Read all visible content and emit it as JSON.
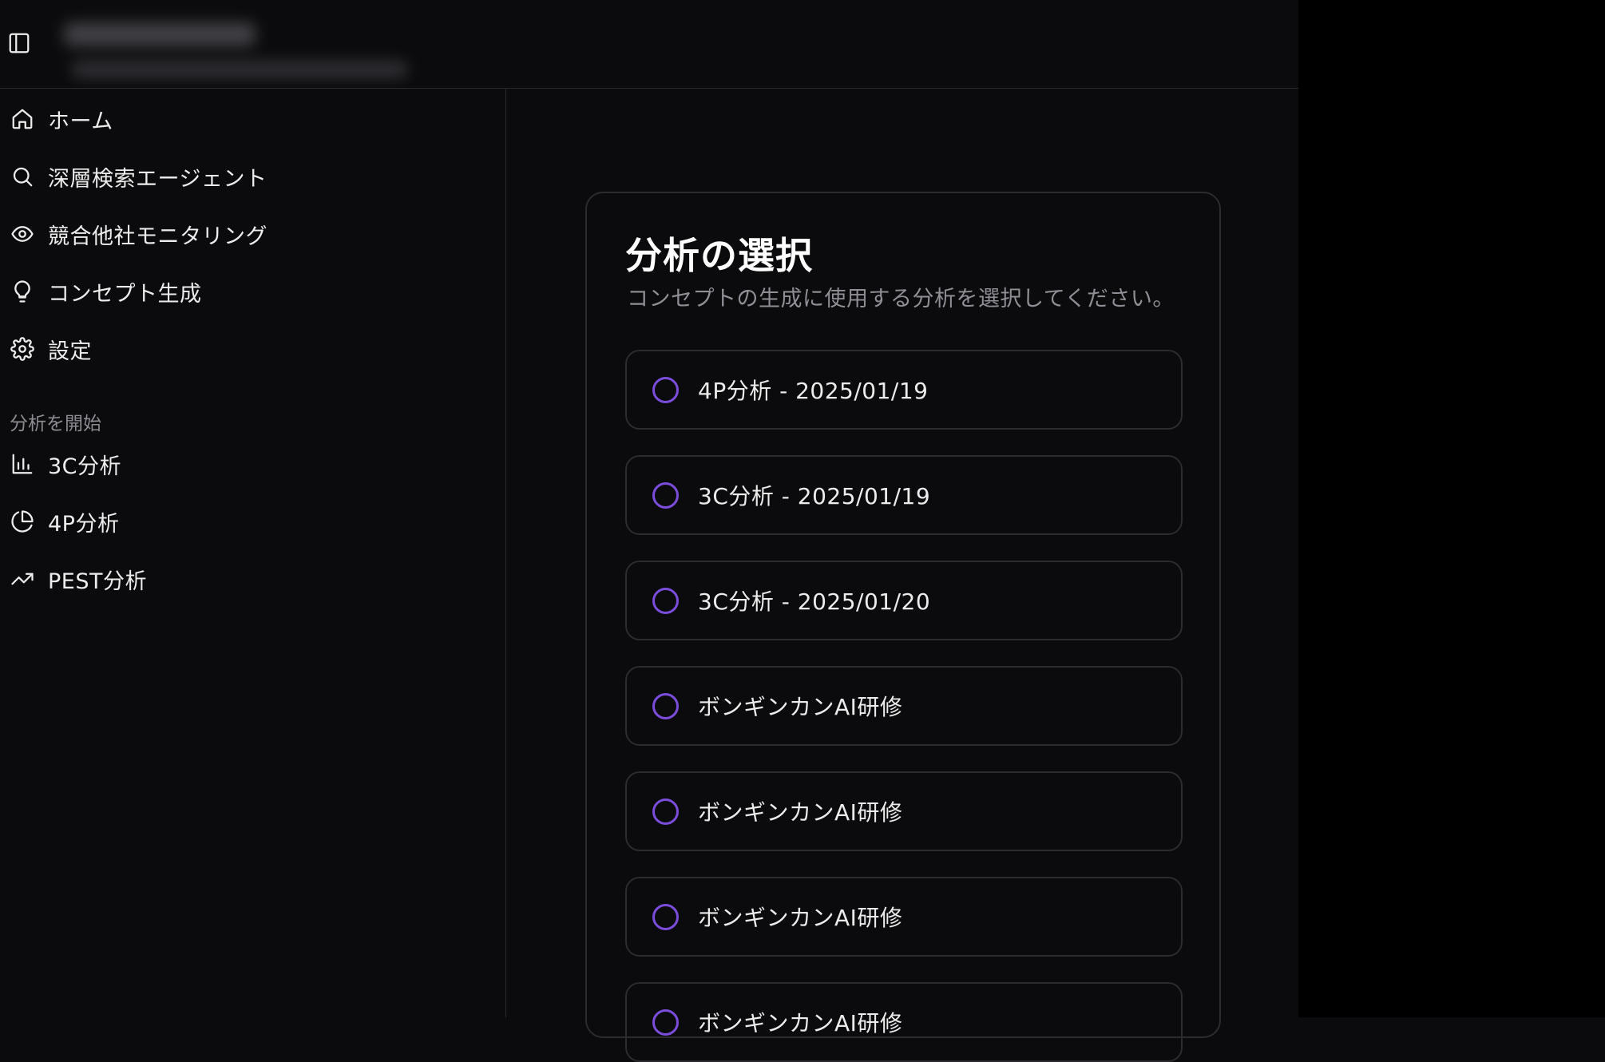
{
  "sidebar": {
    "nav": [
      {
        "label": "ホーム",
        "icon": "home-icon"
      },
      {
        "label": "深層検索エージェント",
        "icon": "search-icon"
      },
      {
        "label": "競合他社モニタリング",
        "icon": "eye-icon"
      },
      {
        "label": "コンセプト生成",
        "icon": "lightbulb-icon"
      },
      {
        "label": "設定",
        "icon": "gear-icon"
      }
    ],
    "section_title": "分析を開始",
    "analysis": [
      {
        "label": "3C分析",
        "icon": "bar-chart-icon"
      },
      {
        "label": "4P分析",
        "icon": "pie-chart-icon"
      },
      {
        "label": "PEST分析",
        "icon": "trending-up-icon"
      }
    ]
  },
  "main": {
    "title": "分析の選択",
    "description": "コンセプトの生成に使用する分析を選択してください。",
    "options": [
      {
        "label": "4P分析 - 2025/01/19"
      },
      {
        "label": "3C分析 - 2025/01/19"
      },
      {
        "label": "3C分析 - 2025/01/20"
      },
      {
        "label": "ボンギンカンAI研修"
      },
      {
        "label": "ボンギンカンAI研修"
      },
      {
        "label": "ボンギンカンAI研修"
      },
      {
        "label": "ボンギンカンAI研修"
      }
    ]
  },
  "colors": {
    "background": "#0b0b0d",
    "accent": "#7c4ddb",
    "border": "#2c2c30",
    "muted_text": "#8f8f96"
  }
}
